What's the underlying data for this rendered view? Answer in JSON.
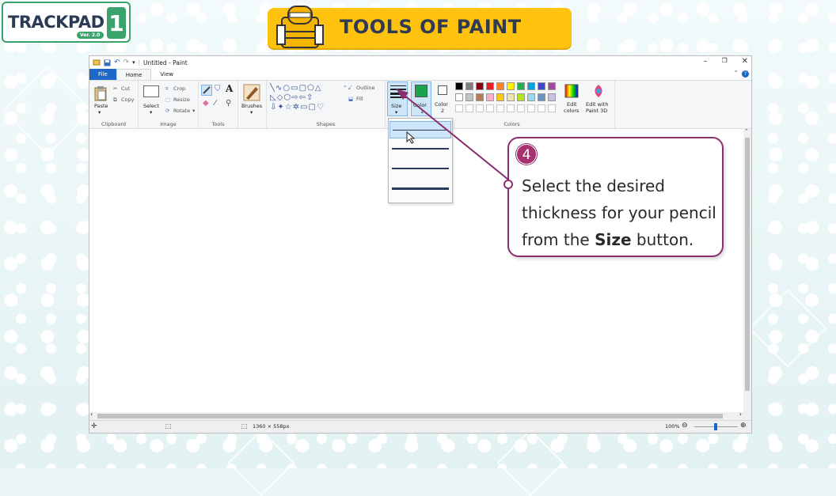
{
  "branding": {
    "logo_text": "TRACKPAD",
    "logo_version": "Ver. 2.0",
    "logo_number": "1",
    "banner_title": "TOOLS OF PAINT"
  },
  "window": {
    "title": "Untitled - Paint",
    "controls": [
      "–",
      "❐",
      "✕"
    ]
  },
  "menu": {
    "file": "File",
    "home": "Home",
    "view": "View"
  },
  "ribbon": {
    "clipboard": {
      "label": "Clipboard",
      "paste": "Paste",
      "cut": "Cut",
      "copy": "Copy"
    },
    "image": {
      "label": "Image",
      "select": "Select",
      "crop": "Crop",
      "resize": "Resize",
      "rotate": "Rotate"
    },
    "tools": {
      "label": "Tools"
    },
    "brushes": {
      "label": "Brushes"
    },
    "shapes": {
      "label": "Shapes",
      "outline": "Outline",
      "fill": "Fill"
    },
    "size": {
      "label": "Size"
    },
    "colors": {
      "label": "Colors",
      "color1": "Color 1",
      "color1_short": "1",
      "color2": "Color",
      "color2_num": "2",
      "edit": "Edit colors",
      "edit_line1": "Edit",
      "edit_line2": "colors",
      "paint3d_line1": "Edit with",
      "paint3d_line2": "Paint 3D",
      "color1_value": "#1aa34a",
      "color2_value": "#ffffff",
      "palette_row1": [
        "#000000",
        "#7f7f7f",
        "#880015",
        "#ed1c24",
        "#ff7f27",
        "#fff200",
        "#22b14c",
        "#00a2e8",
        "#3f48cc",
        "#a349a4"
      ],
      "palette_row2": [
        "#ffffff",
        "#c3c3c3",
        "#b97a57",
        "#ffaec9",
        "#ffc90e",
        "#efe4b0",
        "#b5e61d",
        "#99d9ea",
        "#7092be",
        "#c8bfe7"
      ],
      "palette_row3": [
        "#ffffff",
        "#ffffff",
        "#ffffff",
        "#ffffff",
        "#ffffff",
        "#ffffff",
        "#ffffff",
        "#ffffff",
        "#ffffff",
        "#ffffff"
      ]
    }
  },
  "size_dropdown": {
    "selected_index": 0,
    "option_count": 4
  },
  "status": {
    "dimensions": "1360 × 558px",
    "zoom": "100%"
  },
  "callout": {
    "step": "4",
    "text_before": "Select the desired thickness for your pencil from the ",
    "text_bold": "Size",
    "text_after": " button."
  },
  "accent_colors": {
    "callout_border": "#8b2f6f",
    "banner": "#ffc20e",
    "brand_green": "#3aa36b"
  }
}
